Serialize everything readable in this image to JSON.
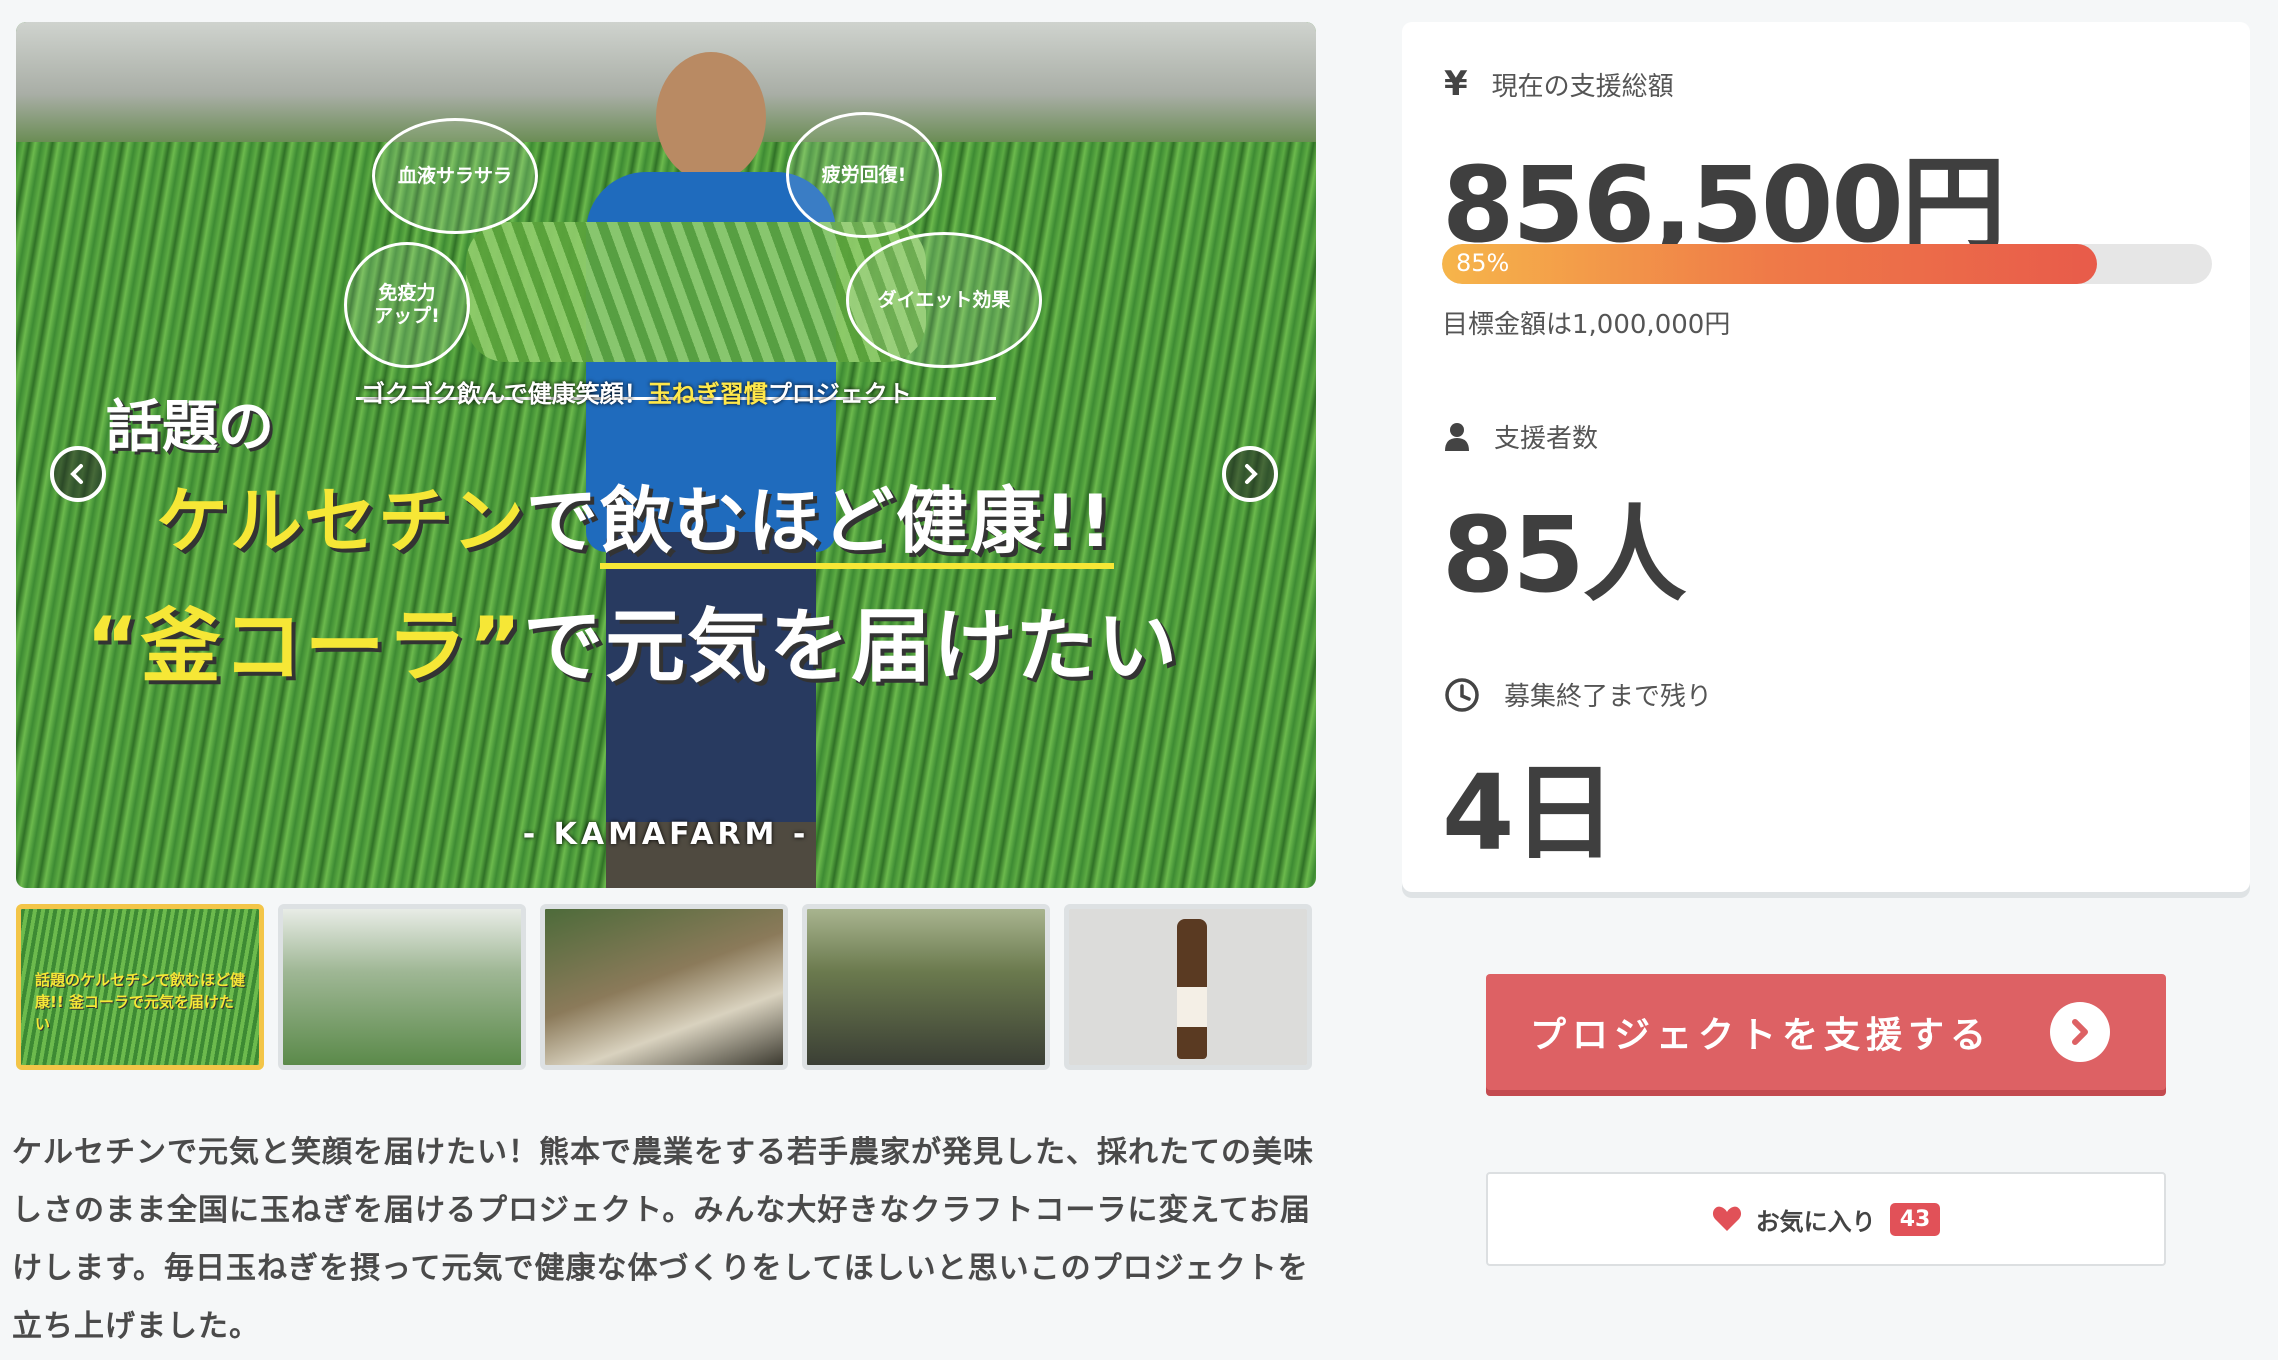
{
  "hero": {
    "bubbles": [
      "血液サラサラ",
      "疲労回復!",
      "免疫力\nアップ!",
      "ダイエット効果"
    ],
    "subtitle_pre": "ゴクゴク飲んで健康笑顔！",
    "subtitle_hl": "玉ねぎ習慣",
    "subtitle_post": "プロジェクト",
    "wadai": "話題の",
    "line1_a": "ケルセチン",
    "line1_b": "で",
    "line1_c": "飲むほど健康!!",
    "line2_a": "“釜コーラ”",
    "line2_b": "で元気を届けたい",
    "brand": "- KAMAFARM -"
  },
  "thumbnails": [
    {
      "label": "話題のケルセチンで飲むほど健康!! 釜コーラで元気を届けたい",
      "active": true
    },
    {
      "label": "",
      "active": false
    },
    {
      "label": "",
      "active": false
    },
    {
      "label": "",
      "active": false
    },
    {
      "label": "",
      "active": false
    }
  ],
  "description": "ケルセチンで元気と笑顔を届けたい！熊本で農業をする若手農家が発見した、採れたての美味しさのまま全国に玉ねぎを届けるプロジェクト。みんな大好きなクラフトコーラに変えてお届けします。毎日玉ねぎを摂って元気で健康な体づくりをしてほしいと思いこのプロジェクトを立ち上げました。",
  "stats": {
    "total_label": "現在の支援総額",
    "total_icon": "yen-icon",
    "total_value": "856,500円",
    "progress_percent": 85,
    "progress_text": "85%",
    "goal_text": "目標金額は1,000,000円",
    "supporters_label": "支援者数",
    "supporters_icon": "person-icon",
    "supporters_value": "85人",
    "remaining_label": "募集終了まで残り",
    "remaining_icon": "clock-icon",
    "remaining_value": "4日"
  },
  "actions": {
    "support_label": "プロジェクトを支援する",
    "favorite_label": "お気に入り",
    "favorite_count": "43"
  },
  "colors": {
    "accent": "#dd6164",
    "progress_start": "#f6b54a",
    "progress_end": "#e85b4a",
    "thumb_active": "#f3c548"
  }
}
